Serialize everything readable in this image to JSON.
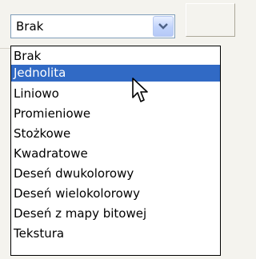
{
  "combo": {
    "value": "Brak",
    "button_icon": "chevron-down-icon"
  },
  "dropdown": {
    "selected_index": 1,
    "items": [
      {
        "label": "Brak"
      },
      {
        "label": "Jednolita"
      },
      {
        "label": "Liniowo"
      },
      {
        "label": "Promieniowe"
      },
      {
        "label": "Stożkowe"
      },
      {
        "label": "Kwadratowe"
      },
      {
        "label": "Deseń dwukolorowy"
      },
      {
        "label": "Deseń wielokolorowy"
      },
      {
        "label": "Deseń z mapy bitowej"
      },
      {
        "label": "Tekstura"
      }
    ]
  },
  "colors": {
    "selection_background": "#316ac5",
    "selection_text": "#ffffff"
  },
  "cursor_icon": "mouse-pointer-icon"
}
